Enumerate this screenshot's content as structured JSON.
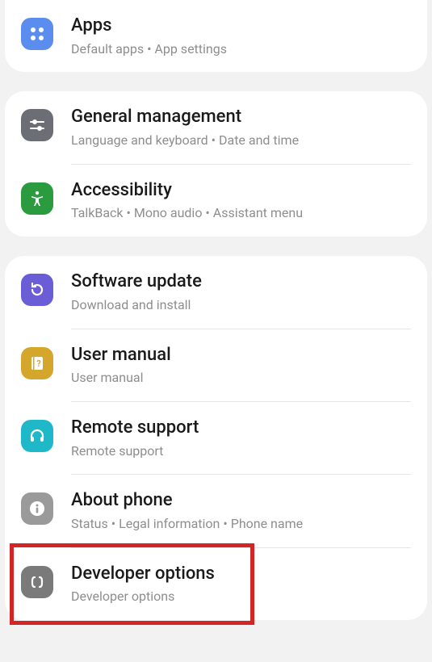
{
  "groups": [
    {
      "items": [
        {
          "id": "apps",
          "title": "Apps",
          "subtitle": "Default apps  •  App settings",
          "iconBg": "#5b8def",
          "iconName": "apps-icon"
        }
      ]
    },
    {
      "items": [
        {
          "id": "general",
          "title": "General management",
          "subtitle": "Language and keyboard  •  Date and time",
          "iconBg": "#6b6f75",
          "iconName": "sliders-icon"
        },
        {
          "id": "accessibility",
          "title": "Accessibility",
          "subtitle": "TalkBack  •  Mono audio  •  Assistant menu",
          "iconBg": "#2a9b3f",
          "iconName": "accessibility-icon"
        }
      ]
    },
    {
      "items": [
        {
          "id": "software-update",
          "title": "Software update",
          "subtitle": "Download and install",
          "iconBg": "#6b5dd6",
          "iconName": "update-icon"
        },
        {
          "id": "user-manual",
          "title": "User manual",
          "subtitle": "User manual",
          "iconBg": "#d4a72c",
          "iconName": "manual-icon"
        },
        {
          "id": "remote-support",
          "title": "Remote support",
          "subtitle": "Remote support",
          "iconBg": "#1fb8c9",
          "iconName": "headset-icon"
        },
        {
          "id": "about-phone",
          "title": "About phone",
          "subtitle": "Status  •  Legal information  •  Phone name",
          "iconBg": "#9a9a9a",
          "iconName": "info-icon"
        },
        {
          "id": "developer-options",
          "title": "Developer options",
          "subtitle": "Developer options",
          "iconBg": "#7a7a7a",
          "iconName": "developer-icon",
          "highlighted": true
        }
      ]
    }
  ]
}
